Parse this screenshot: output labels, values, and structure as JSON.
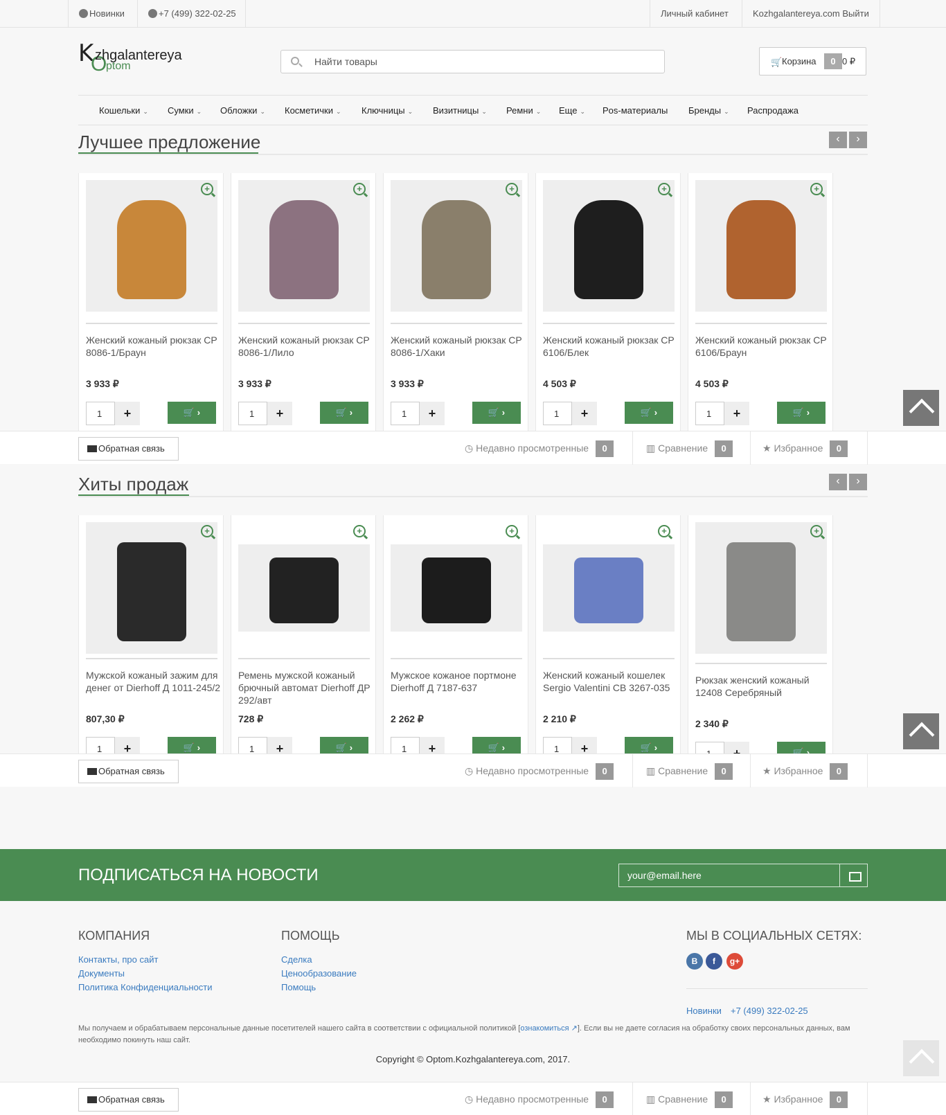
{
  "topbar": {
    "news": "Новинки",
    "phone": "+7 (499) 322-02-25",
    "account": "Личный кабинет",
    "user_logout": "Kozhgalantereya.com Выйти"
  },
  "logo": {
    "k": "K",
    "o": "O",
    "line1": "zhgalantereya",
    "line2": "ptom"
  },
  "search": {
    "placeholder": "Найти товары"
  },
  "cart": {
    "label": "Корзина",
    "count": "0",
    "sum": "0 ₽"
  },
  "menu": [
    "Кошельки",
    "Сумки",
    "Обложки",
    "Косметички",
    "Ключницы",
    "Визитницы",
    "Ремни",
    "Еще",
    "Pos-материалы",
    "Бренды",
    "Распродажа"
  ],
  "sections": [
    {
      "title": "Лучшее предложение",
      "products": [
        {
          "name": "Женский кожаный рюкзак CP 8086-1/Браун",
          "price": "3 933 ₽",
          "qty": "1",
          "color": "#c8873a"
        },
        {
          "name": "Женский кожаный рюкзак CP 8086-1/Лило",
          "price": "3 933 ₽",
          "qty": "1",
          "color": "#8c7280"
        },
        {
          "name": "Женский кожаный рюкзак CP 8086-1/Хаки",
          "price": "3 933 ₽",
          "qty": "1",
          "color": "#8a7f6b"
        },
        {
          "name": "Женский кожаный рюкзак CP 6106/Блек",
          "price": "4 503 ₽",
          "qty": "1",
          "color": "#1e1e1e"
        },
        {
          "name": "Женский кожаный рюкзак CP 6106/Браун",
          "price": "4 503 ₽",
          "qty": "1",
          "color": "#b0632f"
        }
      ]
    },
    {
      "title": "Хиты продаж",
      "products": [
        {
          "name": "Мужской кожаный зажим для денег от Dierhoff Д 1011-245/2",
          "price": "807,30 ₽",
          "qty": "1",
          "color": "#2a2a2a"
        },
        {
          "name": "Ремень мужской кожаный брючный автомат Dierhoff ДР 292/авт",
          "price": "728 ₽",
          "qty": "1",
          "color": "#222222"
        },
        {
          "name": "Мужское кожаное портмоне Dierhoff Д 7187-637",
          "price": "2 262 ₽",
          "qty": "1",
          "color": "#1c1c1c"
        },
        {
          "name": "Женский кожаный кошелек Sergio Valentini CB 3267-035",
          "price": "2 210 ₽",
          "qty": "1",
          "color": "#6a7fc4"
        },
        {
          "name": "Рюкзак женский кожаный 12408 Серебряный",
          "price": "2 340 ₽",
          "qty": "1",
          "color": "#8a8a88"
        }
      ]
    }
  ],
  "bottombar": {
    "feedback": "Обратная связь",
    "recent": "Недавно просмотренные",
    "recent_count": "0",
    "compare": "Сравнение",
    "compare_count": "0",
    "favorites": "Избранное",
    "favorites_count": "0"
  },
  "subscribe": {
    "title": "ПОДПИСАТЬСЯ НА НОВОСТИ",
    "email_placeholder": "your@email.here"
  },
  "footer": {
    "company_title": "КОМПАНИЯ",
    "company_links": [
      "Контакты, про сайт",
      "Документы",
      "Политика Конфиденциальности"
    ],
    "help_title": "ПОМОЩЬ",
    "help_links": [
      "Сделка",
      "Ценообразование",
      "Помощь"
    ],
    "social_title": "МЫ В СОЦИАЛЬНЫХ СЕТЯХ:",
    "social": [
      {
        "label": "B",
        "color": "#4a76a8"
      },
      {
        "label": "f",
        "color": "#3b5998"
      },
      {
        "label": "g+",
        "color": "#dd4b39"
      }
    ],
    "news": "Новинки",
    "phone": "+7 (499) 322-02-25",
    "legal_before": "Мы получаем и обрабатываем персональные данные посетителей нашего сайта в соответствии с официальной политикой [",
    "legal_link": "ознакомиться",
    "legal_after": "]. Если вы не даете согласия на обработку своих персональных данных, вам необходимо покинуть наш сайт.",
    "copyright": "Copyright © Optom.Kozhgalantereya.com, 2017."
  }
}
